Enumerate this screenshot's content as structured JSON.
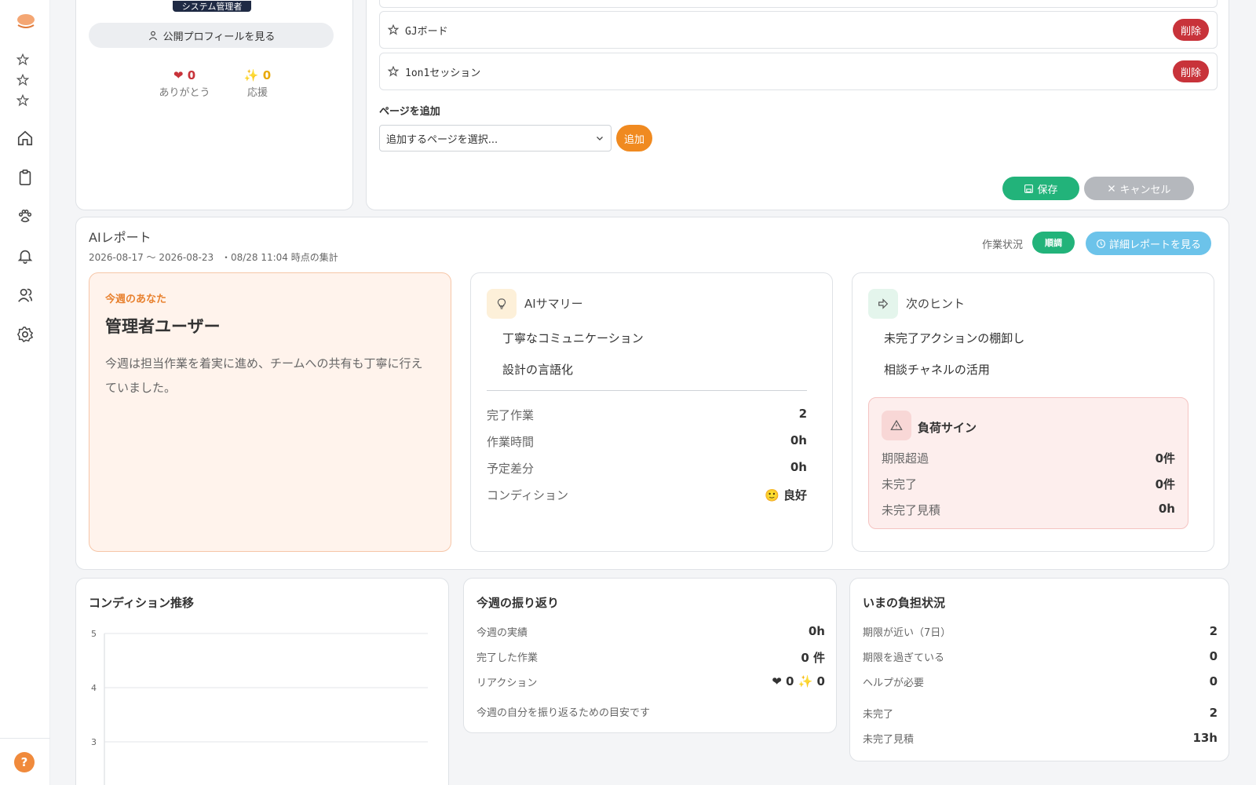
{
  "sidebar": {
    "icons": [
      "logo-icon",
      "star-icon",
      "star-icon",
      "star-icon",
      "home-icon",
      "clipboard-icon",
      "paw-icon",
      "bell-icon",
      "users-icon",
      "gear-icon"
    ],
    "help_label": "?"
  },
  "profile": {
    "role_badge": "システム管理者",
    "public_profile_button": "公開プロフィールを見る",
    "thanks": {
      "icon": "❤",
      "value": "0",
      "label": "ありがとう"
    },
    "cheer": {
      "icon": "✨",
      "value": "0",
      "label": "応援"
    }
  },
  "favorites": {
    "items": [
      {
        "label": "GJボード",
        "delete_label": "削除"
      },
      {
        "label": "1on1セッション",
        "delete_label": "削除"
      }
    ],
    "add_page_label": "ページを追加",
    "select_placeholder": "追加するページを選択...",
    "add_button": "追加",
    "save_button": "保存",
    "cancel_button": "キャンセル"
  },
  "ai_report": {
    "title": "AIレポート",
    "period": "2026-08-17 〜 2026-08-23",
    "aggregated_at": "・08/28 11:04 時点の集計",
    "status_label": "作業状況",
    "status_value": "順調",
    "detail_button": "詳細レポートを見る",
    "you": {
      "tag": "今週のあなた",
      "name": "管理者ユーザー",
      "description": "今週は担当作業を着実に進め、チームへの共有も丁寧に行えていました。"
    },
    "summary": {
      "title": "AIサマリー",
      "points": [
        "丁寧なコミュニケーション",
        "設計の言語化"
      ],
      "stats": [
        {
          "label": "完了作業",
          "value": "2"
        },
        {
          "label": "作業時間",
          "value": "0h"
        },
        {
          "label": "予定差分",
          "value": "0h"
        },
        {
          "label": "コンディション",
          "value": "🙂 良好"
        }
      ]
    },
    "hints": {
      "title": "次のヒント",
      "points": [
        "未完了アクションの棚卸し",
        "相談チャネルの活用"
      ],
      "load": {
        "title": "負荷サイン",
        "stats": [
          {
            "label": "期限超過",
            "value": "0件"
          },
          {
            "label": "未完了",
            "value": "0件"
          },
          {
            "label": "未完了見積",
            "value": "0h"
          }
        ]
      }
    }
  },
  "condition_trend": {
    "title": "コンディション推移",
    "chart_data": {
      "type": "line",
      "title": "コンディション推移",
      "y_ticks": [
        5,
        4,
        3
      ],
      "series": []
    }
  },
  "weekly_review": {
    "title": "今週の振り返り",
    "rows": [
      {
        "label": "今週の実績",
        "value": "0h"
      },
      {
        "label": "完了した作業",
        "value": "0 件"
      }
    ],
    "reaction_label": "リアクション",
    "reaction_value": "❤ 0  ✨ 0",
    "note": "今週の自分を振り返るための目安です"
  },
  "workload": {
    "title": "いまの負担状況",
    "rows": [
      {
        "label": "期限が近い（7日）",
        "value": "2"
      },
      {
        "label": "期限を過ぎている",
        "value": "0"
      },
      {
        "label": "ヘルプが必要",
        "value": "0"
      },
      {
        "label": "未完了",
        "value": "2"
      },
      {
        "label": "未完了見積",
        "value": "13h"
      }
    ]
  },
  "colors": {
    "accent_orange": "#f08a20",
    "success_green": "#22b37a",
    "danger_red": "#c8333a",
    "info_blue": "#6cc3ea"
  }
}
